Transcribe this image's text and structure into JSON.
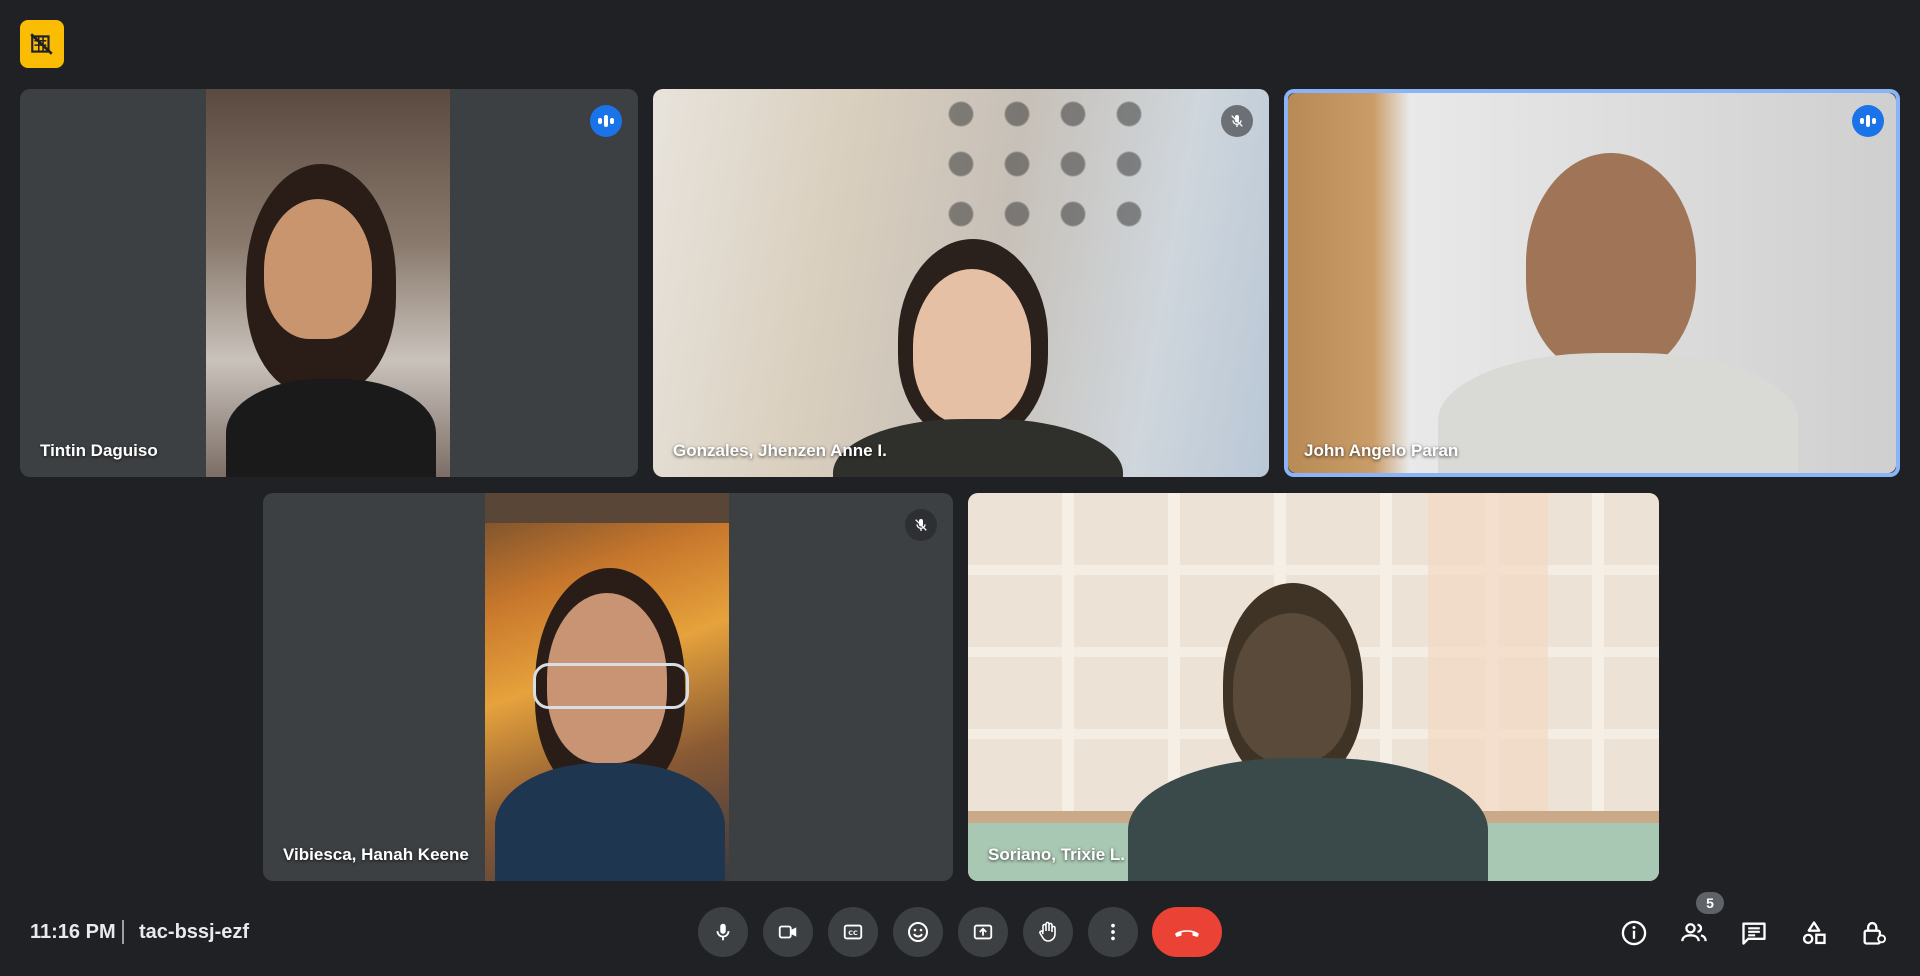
{
  "meeting": {
    "time": "11:16 PM",
    "code": "tac-bssj-ezf",
    "participant_count": "5"
  },
  "participants": [
    {
      "name": "Tintin Daguiso",
      "status": "speaking"
    },
    {
      "name": "Gonzales, Jhenzen Anne I.",
      "status": "muted"
    },
    {
      "name": "John Angelo Paran",
      "status": "speaking"
    },
    {
      "name": "Vibiesca, Hanah Keene",
      "status": "muted"
    },
    {
      "name": "Soriano, Trixie L.",
      "status": "none"
    }
  ],
  "controls": [
    "microphone-icon",
    "camera-icon",
    "captions-icon",
    "emoji-icon",
    "present-screen-icon",
    "raise-hand-icon",
    "more-options-icon",
    "end-call-icon"
  ],
  "right_controls": [
    "info-icon",
    "people-icon",
    "chat-icon",
    "activities-icon",
    "host-controls-icon"
  ],
  "colors": {
    "background": "#202124",
    "tile": "#3c4043",
    "speaking": "#1a73e8",
    "active_border": "#8ab4f8",
    "end_call": "#ea4335",
    "badge": "#fbbc04"
  }
}
